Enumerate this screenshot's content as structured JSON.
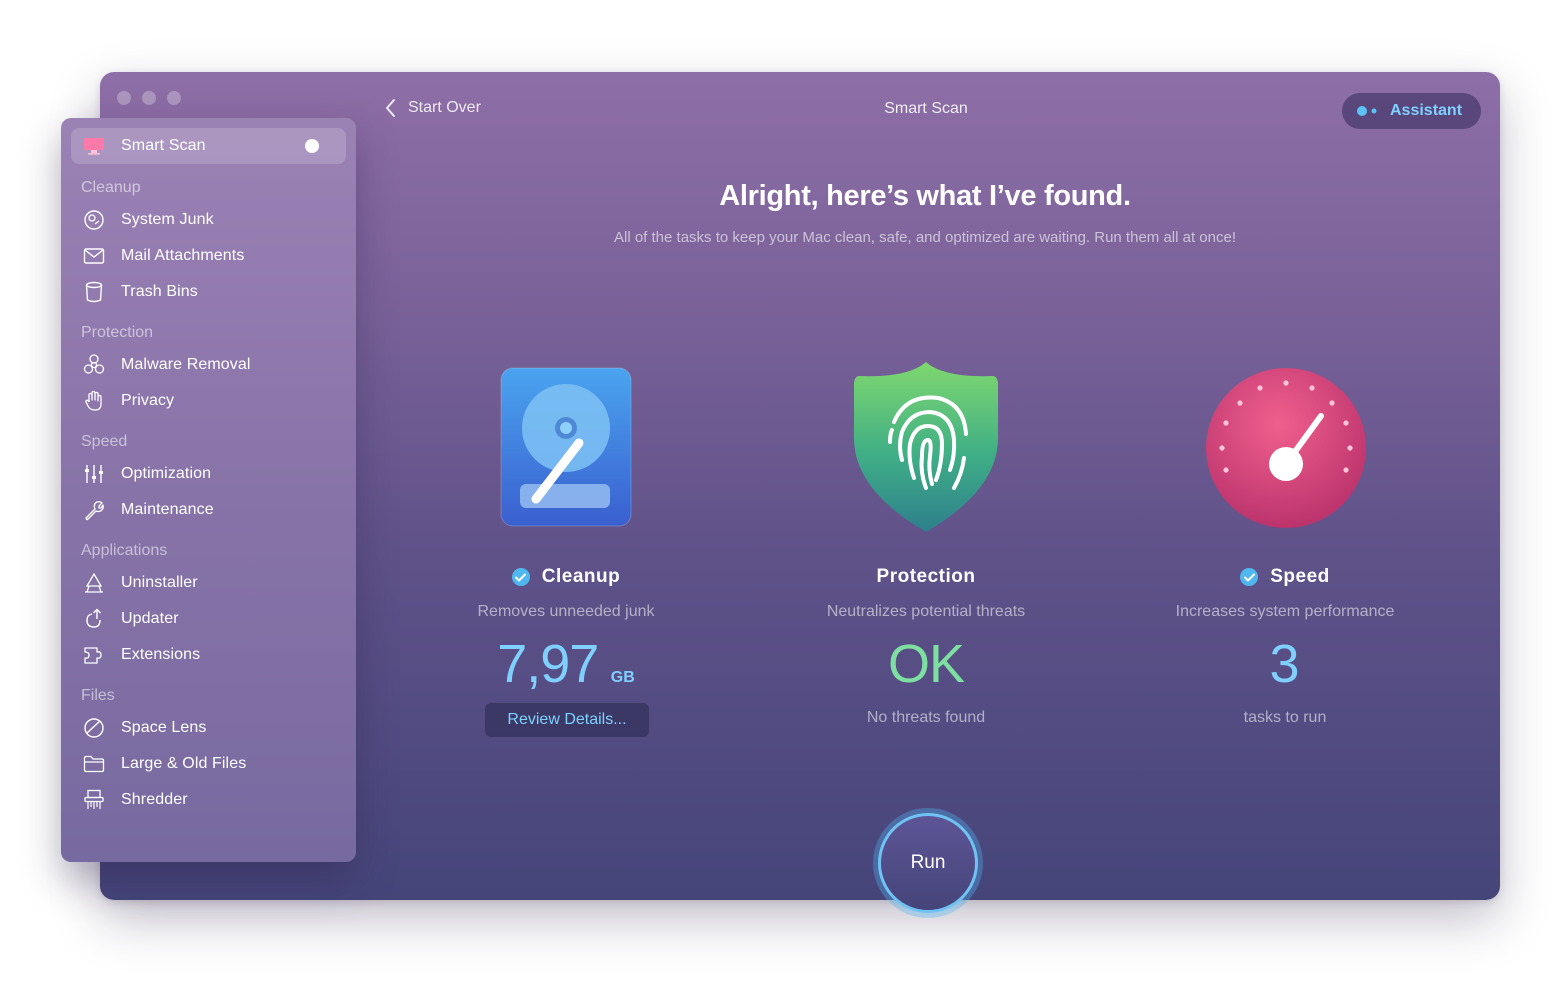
{
  "header": {
    "back_label": "Start Over",
    "title": "Smart Scan",
    "assistant_label": "Assistant"
  },
  "sidebar": {
    "active": {
      "label": "Smart Scan",
      "icon": "smart-scan-icon"
    },
    "sections": [
      {
        "heading": "Cleanup",
        "items": [
          {
            "label": "System Junk",
            "icon": "system-junk-icon"
          },
          {
            "label": "Mail Attachments",
            "icon": "mail-icon"
          },
          {
            "label": "Trash Bins",
            "icon": "trash-icon"
          }
        ]
      },
      {
        "heading": "Protection",
        "items": [
          {
            "label": "Malware Removal",
            "icon": "biohazard-icon"
          },
          {
            "label": "Privacy",
            "icon": "hand-icon"
          }
        ]
      },
      {
        "heading": "Speed",
        "items": [
          {
            "label": "Optimization",
            "icon": "sliders-icon"
          },
          {
            "label": "Maintenance",
            "icon": "wrench-icon"
          }
        ]
      },
      {
        "heading": "Applications",
        "items": [
          {
            "label": "Uninstaller",
            "icon": "uninstaller-icon"
          },
          {
            "label": "Updater",
            "icon": "updater-icon"
          },
          {
            "label": "Extensions",
            "icon": "extensions-icon"
          }
        ]
      },
      {
        "heading": "Files",
        "items": [
          {
            "label": "Space Lens",
            "icon": "space-lens-icon"
          },
          {
            "label": "Large & Old Files",
            "icon": "folder-icon"
          },
          {
            "label": "Shredder",
            "icon": "shredder-icon"
          }
        ]
      }
    ]
  },
  "main": {
    "headline": "Alright, here’s what I’ve found.",
    "subline": "All of the tasks to keep your Mac clean, safe, and optimized are waiting. Run them all at once!",
    "cards": [
      {
        "title": "Cleanup",
        "desc": "Removes unneeded junk",
        "value": "7,97",
        "unit": "GB",
        "action": "Review Details...",
        "checked": true,
        "color": "#7fd0ff"
      },
      {
        "title": "Protection",
        "desc": "Neutralizes potential threats",
        "value": "OK",
        "caption": "No threats found",
        "checked": false,
        "color": "#7ee0a0"
      },
      {
        "title": "Speed",
        "desc": "Increases system performance",
        "value": "3",
        "caption": "tasks to run",
        "checked": true,
        "color": "#7fd0ff"
      }
    ],
    "run_label": "Run"
  },
  "colors": {
    "accent": "#7fd0ff",
    "ok_green": "#7ee0a0",
    "check_blue": "#4fb7ee"
  }
}
